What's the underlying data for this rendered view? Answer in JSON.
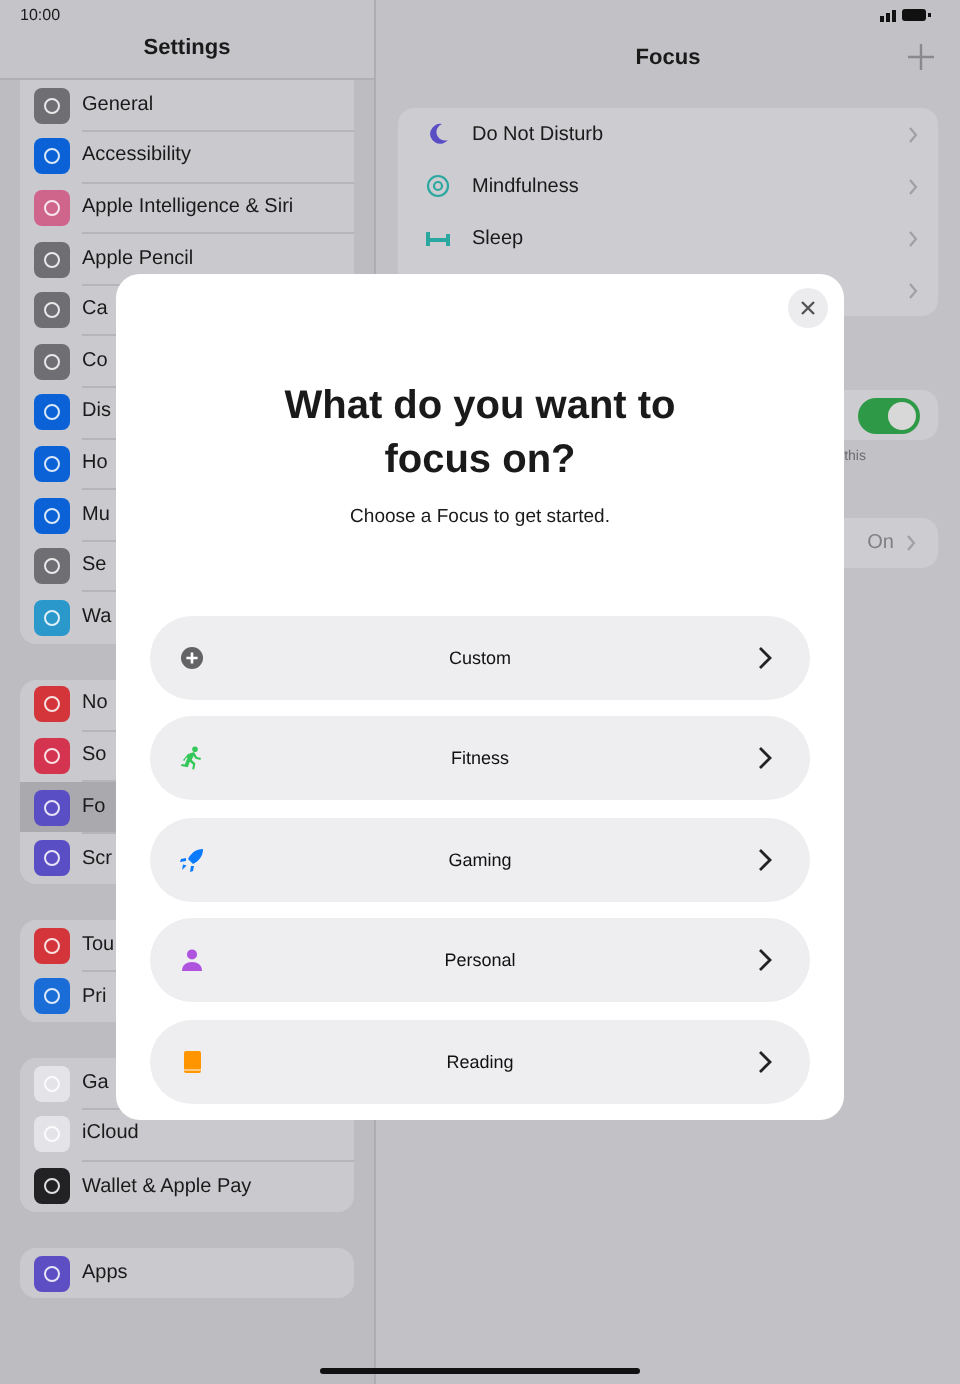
{
  "status_bar": {
    "time": "10:00"
  },
  "sidebar": {
    "title": "Settings",
    "groups": [
      {
        "items": [
          {
            "label": "General",
            "color": "#6e6e73",
            "selected": false
          },
          {
            "label": "Accessibility",
            "color": "#0b62d6",
            "selected": false
          },
          {
            "label": "Apple Intelligence & Siri",
            "color": "#d0658c",
            "selected": false
          },
          {
            "label": "Apple Pencil",
            "color": "#6e6e73",
            "selected": false
          },
          {
            "label": "Ca",
            "color": "#6e6e73",
            "selected": false
          },
          {
            "label": "Co",
            "color": "#6e6e73",
            "selected": false
          },
          {
            "label": "Dis",
            "color": "#0b62d6",
            "selected": false
          },
          {
            "label": "Ho",
            "color": "#0b62d6",
            "selected": false
          },
          {
            "label": "Mu",
            "color": "#0b62d6",
            "selected": false
          },
          {
            "label": "Se",
            "color": "#6e6e73",
            "selected": false
          },
          {
            "label": "Wa",
            "color": "#2b98cc",
            "selected": false
          }
        ]
      },
      {
        "items": [
          {
            "label": "No",
            "color": "#d4353b",
            "selected": false
          },
          {
            "label": "So",
            "color": "#d4344f",
            "selected": false
          },
          {
            "label": "Fo",
            "color": "#5a4ec4",
            "selected": true
          },
          {
            "label": "Scr",
            "color": "#5a4ec4",
            "selected": false
          }
        ]
      },
      {
        "items": [
          {
            "label": "Tou",
            "color": "#d4353b",
            "selected": false
          },
          {
            "label": "Pri",
            "color": "#1a6dd6",
            "selected": false
          }
        ]
      },
      {
        "items": [
          {
            "label": "Ga",
            "color": "#e4e4e8",
            "selected": false
          },
          {
            "label": "iCloud",
            "color": "#e4e4e8",
            "selected": false
          },
          {
            "label": "Wallet & Apple Pay",
            "color": "#222224",
            "selected": false
          }
        ]
      },
      {
        "items": [
          {
            "label": "Apps",
            "color": "#5e4ec4",
            "selected": false
          }
        ]
      }
    ]
  },
  "main": {
    "title": "Focus",
    "focus_list": [
      {
        "label": "Do Not Disturb",
        "color": "#5a4ec4"
      },
      {
        "label": "Mindfulness",
        "color": "#2aa8a0"
      },
      {
        "label": "Sleep",
        "color": "#2aa8a0"
      }
    ],
    "toggle": {
      "on": true
    },
    "footnote": "this",
    "setting_value": "On"
  },
  "modal": {
    "title": "What do you want to focus on?",
    "subtitle": "Choose a Focus to get started.",
    "options": [
      {
        "label": "Custom",
        "color": "#636366"
      },
      {
        "label": "Fitness",
        "color": "#34c759"
      },
      {
        "label": "Gaming",
        "color": "#0a7aff"
      },
      {
        "label": "Personal",
        "color": "#af52de"
      },
      {
        "label": "Reading",
        "color": "#ff9500"
      }
    ]
  }
}
